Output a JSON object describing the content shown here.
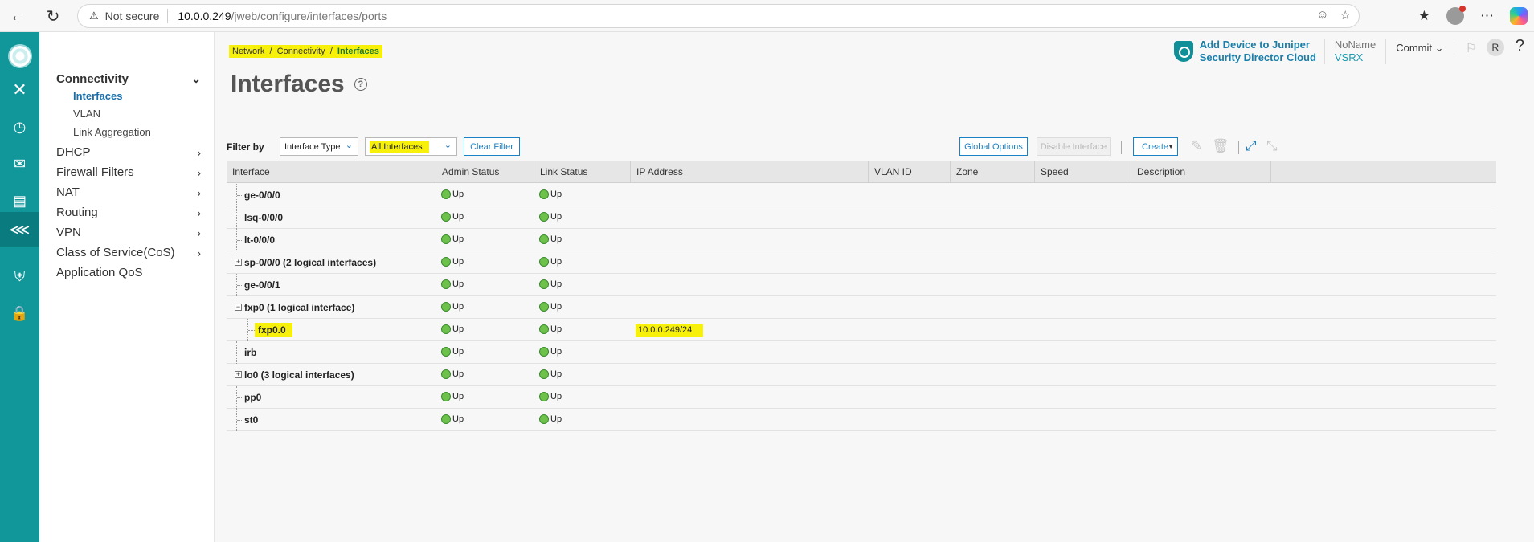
{
  "browser": {
    "security_warning": "Not secure",
    "url_host": "10.0.0.249",
    "url_path": "/jweb/configure/interfaces/ports"
  },
  "sidebar": {
    "connectivity": {
      "label": "Connectivity",
      "children": [
        "Interfaces",
        "VLAN",
        "Link Aggregation"
      ]
    },
    "items": [
      "DHCP",
      "Firewall Filters",
      "NAT",
      "Routing",
      "VPN",
      "Class of Service(CoS)",
      "Application QoS"
    ]
  },
  "header": {
    "breadcrumb": [
      "Network",
      "Connectivity",
      "Interfaces"
    ],
    "breadcrumb_sep": "/",
    "title": "Interfaces",
    "help_icon_text": "?",
    "jsd_line1": "Add Device to Juniper",
    "jsd_line2": "Security Director Cloud",
    "node_name": "NoName",
    "node_model": "VSRX",
    "commit_label": "Commit",
    "user_initial": "R",
    "help_label": "?"
  },
  "filter": {
    "label": "Filter by",
    "type_value": "Interface Type",
    "scope_value": "All Interfaces",
    "clear_label": "Clear Filter"
  },
  "toolbar": {
    "global_options": "Global Options",
    "disable_interface": "Disable Interface",
    "create": "Create"
  },
  "table": {
    "columns": [
      "Interface",
      "Admin Status",
      "Link Status",
      "IP Address",
      "VLAN ID",
      "Zone",
      "Speed",
      "Description"
    ],
    "rows": [
      {
        "name": "ge-0/0/0",
        "admin": "Up",
        "link": "Up",
        "ip": ""
      },
      {
        "name": "lsq-0/0/0",
        "admin": "Up",
        "link": "Up",
        "ip": ""
      },
      {
        "name": "lt-0/0/0",
        "admin": "Up",
        "link": "Up",
        "ip": ""
      },
      {
        "name": "sp-0/0/0 (2 logical interfaces)",
        "admin": "Up",
        "link": "Up",
        "ip": "",
        "expander": "+"
      },
      {
        "name": "ge-0/0/1",
        "admin": "Up",
        "link": "Up",
        "ip": ""
      },
      {
        "name": "fxp0 (1 logical interface)",
        "admin": "Up",
        "link": "Up",
        "ip": "",
        "expander": "−"
      },
      {
        "name": "fxp0.0",
        "admin": "Up",
        "link": "Up",
        "ip": "10.0.0.249/24",
        "child": true
      },
      {
        "name": "irb",
        "admin": "Up",
        "link": "Up",
        "ip": ""
      },
      {
        "name": "lo0 (3 logical interfaces)",
        "admin": "Up",
        "link": "Up",
        "ip": "",
        "expander": "+"
      },
      {
        "name": "pp0",
        "admin": "Up",
        "link": "Up",
        "ip": ""
      },
      {
        "name": "st0",
        "admin": "Up",
        "link": "Up",
        "ip": ""
      }
    ]
  },
  "colors": {
    "rail": "#11979a",
    "highlight": "#f6f00a",
    "status_up": "#6cc24a",
    "link_blue": "#1a82c4"
  }
}
